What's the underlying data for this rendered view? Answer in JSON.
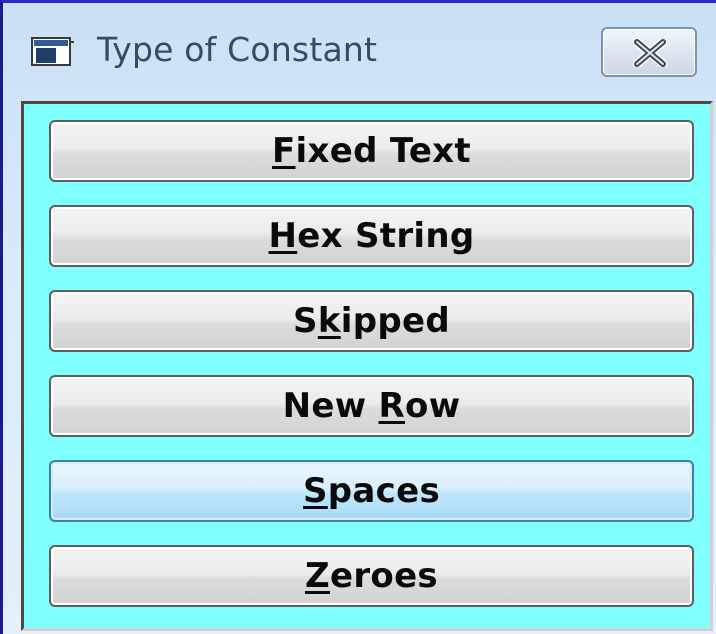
{
  "window": {
    "title": "Type of Constant",
    "icon": "app-window-icon",
    "close_icon": "close-x-icon",
    "client_bg": "#80ffff"
  },
  "options": [
    {
      "label": "Fixed Text",
      "mnemonic": "F",
      "focused": false
    },
    {
      "label": "Hex String",
      "mnemonic": "H",
      "focused": false
    },
    {
      "label": "Skipped",
      "mnemonic": "k",
      "focused": false
    },
    {
      "label": "New Row",
      "mnemonic": "R",
      "focused": false
    },
    {
      "label": "Spaces",
      "mnemonic": "S",
      "focused": true
    },
    {
      "label": "Zeroes",
      "mnemonic": "Z",
      "focused": false
    }
  ]
}
